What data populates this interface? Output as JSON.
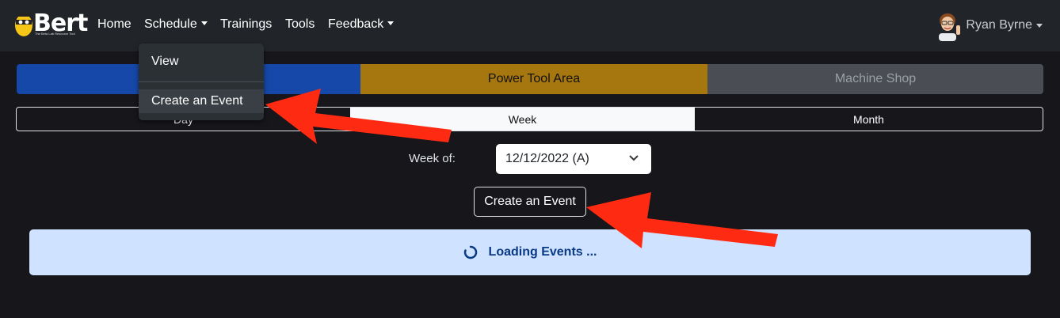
{
  "nav": {
    "brand": "Bert",
    "brand_sub": "The Beta Lab Resource Tool",
    "links": [
      "Home",
      "Schedule",
      "Trainings",
      "Tools",
      "Feedback"
    ],
    "user_name": "Ryan Byrne"
  },
  "areas": [
    "",
    "Power Tool Area",
    "Machine Shop"
  ],
  "views": [
    "Day",
    "Week",
    "Month"
  ],
  "week": {
    "label": "Week of:",
    "value": "12/12/2022 (A)"
  },
  "create_button": "Create an Event",
  "loading_text": "Loading Events ...",
  "dropdown": {
    "items": [
      "View",
      "Create an Event"
    ]
  },
  "colors": {
    "accent": "#1548a8",
    "power_tool": "#a6760f",
    "machine_shop": "#4a4e54",
    "arrow": "#ff2a12"
  }
}
